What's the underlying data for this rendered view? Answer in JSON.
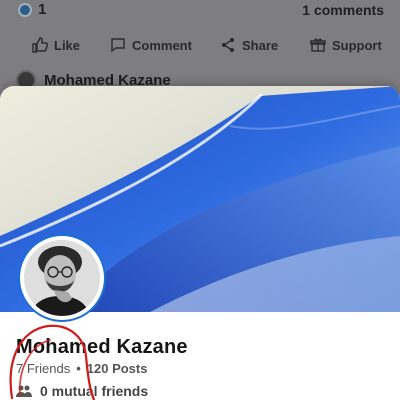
{
  "post": {
    "reaction_count": "1",
    "comments_label": "1 comments",
    "author_name": "Mohamed Kazane"
  },
  "actions": [
    {
      "label": "Like",
      "icon": "thumbs-up-icon"
    },
    {
      "label": "Comment",
      "icon": "comment-icon"
    },
    {
      "label": "Share",
      "icon": "share-icon"
    },
    {
      "label": "Support",
      "icon": "gift-icon"
    }
  ],
  "profile": {
    "name": "Mohamed Kazane",
    "friends": "7 Friends",
    "separator": "•",
    "posts": "120 Posts",
    "mutual": "0 mutual friends"
  },
  "colors": {
    "accent": "#1d6fd6",
    "overlay": "#7e7e80",
    "annotation": "#d11a1a"
  }
}
